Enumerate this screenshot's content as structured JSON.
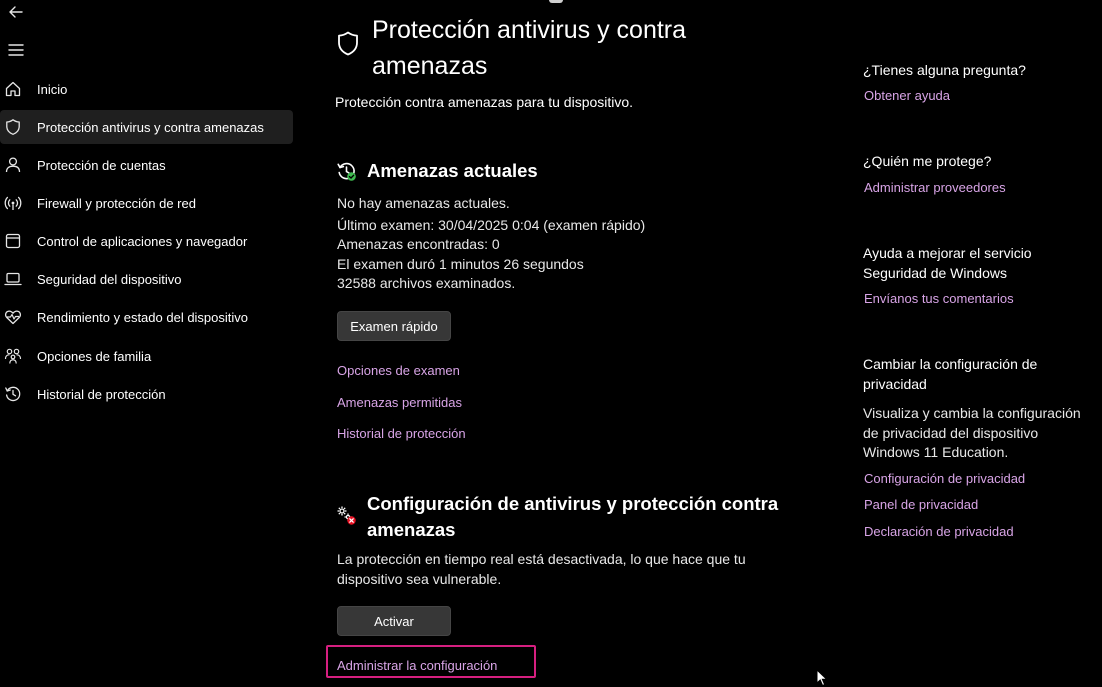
{
  "nav": {
    "back_icon": "back-arrow-icon",
    "menu_icon": "hamburger-menu-icon",
    "items": [
      {
        "label": "Inicio",
        "icon": "home-icon"
      },
      {
        "label": "Protección antivirus y contra amenazas",
        "icon": "shield-icon",
        "selected": true
      },
      {
        "label": "Protección de cuentas",
        "icon": "person-icon"
      },
      {
        "label": "Firewall y protección de red",
        "icon": "wifi-antenna-icon"
      },
      {
        "label": "Control de aplicaciones y navegador",
        "icon": "app-window-icon"
      },
      {
        "label": "Seguridad del dispositivo",
        "icon": "laptop-icon"
      },
      {
        "label": "Rendimiento y estado del dispositivo",
        "icon": "heart-pulse-icon"
      },
      {
        "label": "Opciones de familia",
        "icon": "family-icon"
      },
      {
        "label": "Historial de protección",
        "icon": "history-icon"
      }
    ]
  },
  "main": {
    "title": "Protección antivirus y contra amenazas",
    "subtitle": "Protección contra amenazas para tu dispositivo.",
    "current_threats": {
      "heading": "Amenazas actuales",
      "lines": [
        "No hay amenazas actuales.",
        "Último examen: 30/04/2025 0:04 (examen rápido)",
        "Amenazas encontradas: 0",
        "El examen duró 1 minutos 26 segundos",
        "32588 archivos examinados."
      ],
      "quick_scan_button": "Examen rápido",
      "links": [
        "Opciones de examen",
        "Amenazas permitidas",
        "Historial de protección"
      ]
    },
    "settings": {
      "heading": "Configuración de antivirus y protección contra amenazas",
      "warning": "La protección en tiempo real está desactivada, lo que hace que tu dispositivo sea vulnerable.",
      "activate_button": "Activar",
      "manage_link": "Administrar la configuración"
    }
  },
  "sidebar_right": {
    "sections": [
      {
        "heading": "¿Tienes alguna pregunta?",
        "links": [
          "Obtener ayuda"
        ]
      },
      {
        "heading": "¿Quién me protege?",
        "links": [
          "Administrar proveedores"
        ]
      },
      {
        "heading": "Ayuda a mejorar el servicio Seguridad de Windows",
        "links": [
          "Envíanos tus comentarios"
        ]
      },
      {
        "heading": "Cambiar la configuración de privacidad",
        "text": "Visualiza y cambia la configuración de privacidad del dispositivo Windows 11 Education.",
        "links": [
          "Configuración de privacidad",
          "Panel de privacidad",
          "Declaración de privacidad"
        ]
      }
    ]
  },
  "colors": {
    "background": "#000000",
    "link": "#d8a4e6",
    "highlight_annotation": "#d61f80",
    "status_ok": "#3fb950",
    "status_warning": "#e81123"
  }
}
